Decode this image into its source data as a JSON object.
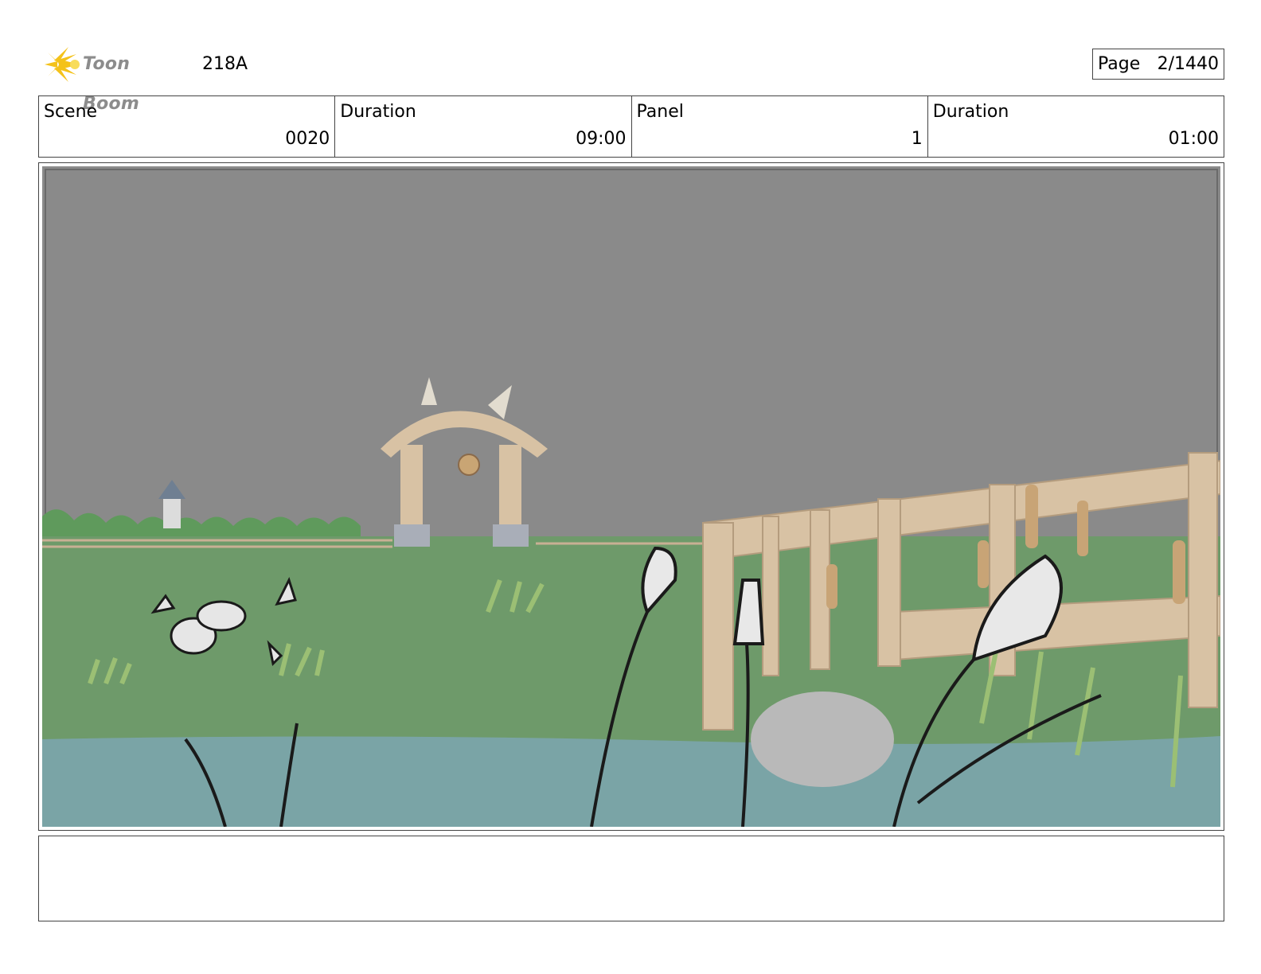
{
  "header": {
    "logo_text": "Toon Boom",
    "board_id": "218A",
    "page_label": "Page",
    "page_value": "2/1440"
  },
  "info": {
    "scene_label": "Scene",
    "scene_value": "0020",
    "scene_duration_label": "Duration",
    "scene_duration_value": "09:00",
    "panel_label": "Panel",
    "panel_value": "1",
    "panel_duration_label": "Duration",
    "panel_duration_value": "01:00"
  },
  "panel": {
    "sky_color": "#8a8a8a",
    "grass_color": "#6e9a6a",
    "water_color": "#7aa4a6",
    "wood_color": "#d8c2a4"
  },
  "notes": {
    "text": ""
  }
}
